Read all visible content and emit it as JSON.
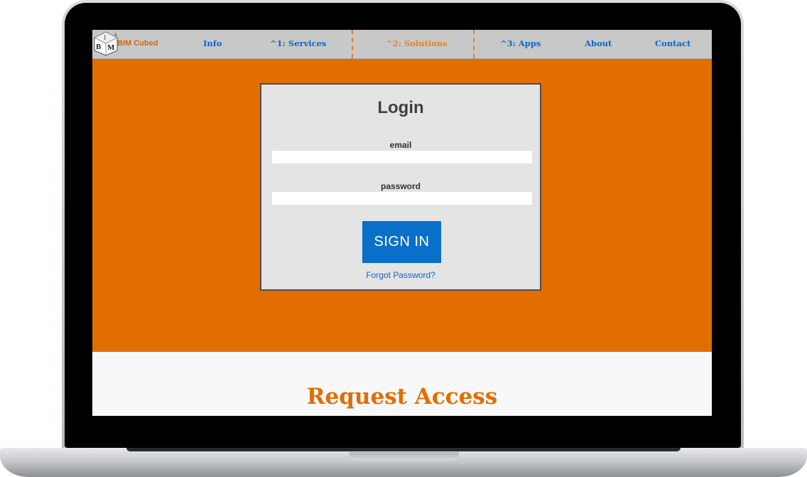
{
  "brand": {
    "name": "BIM Cubed",
    "logo_letters": [
      "B",
      "I",
      "M"
    ],
    "logo_superscript": "3",
    "colors": {
      "accent": "#e26d00",
      "link": "#0a66c8"
    }
  },
  "nav": {
    "items": [
      {
        "label": "Info"
      },
      {
        "label": "^1: Services"
      },
      {
        "label": "^2: Solutions",
        "active": true
      },
      {
        "label": "^3: Apps"
      },
      {
        "label": "About"
      },
      {
        "label": "Contact"
      }
    ]
  },
  "login": {
    "title": "Login",
    "email_label": "email",
    "email_value": "",
    "password_label": "password",
    "password_value": "",
    "submit_label": "SIGN IN",
    "forgot_label": "Forgot Password?"
  },
  "request": {
    "title": "Request Access"
  }
}
